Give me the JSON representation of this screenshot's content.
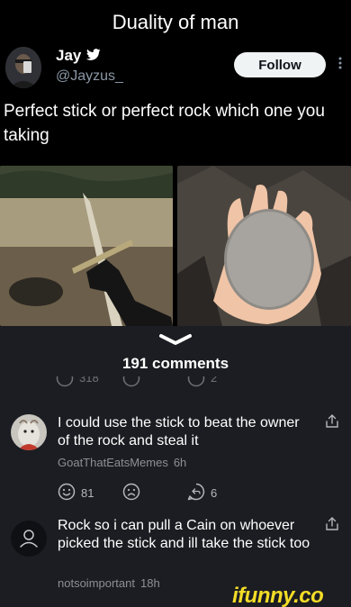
{
  "caption": "Duality of man",
  "tweet": {
    "author": "Jay",
    "handle": "@Jayzus_",
    "follow_label": "Follow",
    "text": "Perfect stick or perfect rock which one you taking"
  },
  "comments_panel": {
    "count_label": "191 comments",
    "ghost_counts": {
      "smile": "318",
      "reply": "2"
    },
    "comments": [
      {
        "text": "I could use the stick to beat the owner of the rock and steal it",
        "username": "GoatThatEatsMemes",
        "time": "6h",
        "smile_count": "81",
        "reply_count": "6"
      },
      {
        "text": "Rock so i can pull a Cain on whoever picked the stick and ill take the stick too",
        "username": "notsoimportant",
        "time": "18h"
      }
    ]
  },
  "watermark": "ifunny.co",
  "colors": {
    "panel": "#1c1d22",
    "meta": "#8e8f95",
    "watermark": "#f2dc27"
  },
  "icons": [
    "verified-bird-icon",
    "more-icon",
    "chevron-down-icon",
    "smile-icon",
    "frown-icon",
    "reply-icon",
    "share-icon",
    "user-placeholder-icon"
  ]
}
